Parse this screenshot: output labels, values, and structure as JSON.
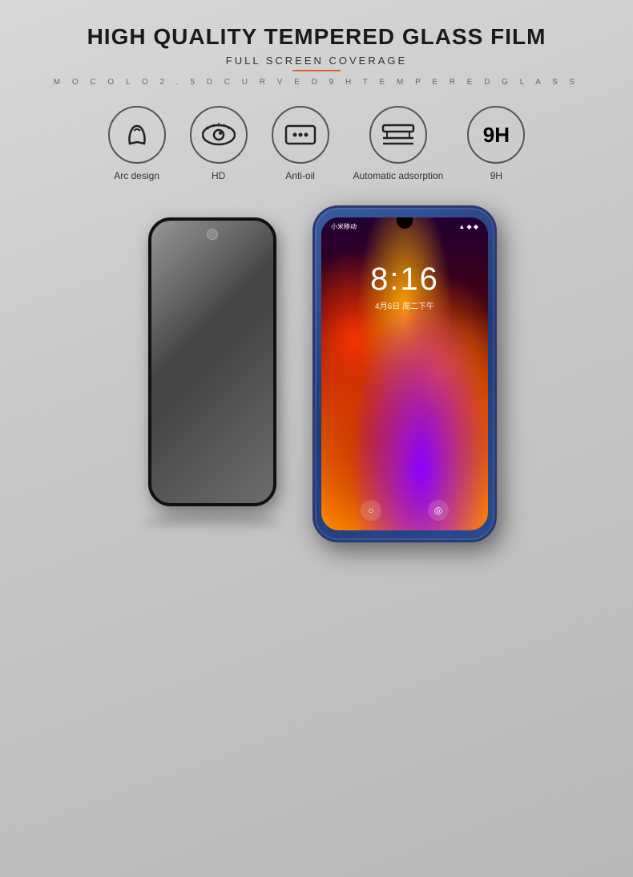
{
  "header": {
    "main_title": "HIGH QUALITY TEMPERED GLASS FILM",
    "sub_title": "FULL SCREEN COVERAGE",
    "tagline": "M O C O L O   2 . 5 D   C U R V E D   9 H   T E M P E R E D   G L A S S"
  },
  "features": [
    {
      "id": "arc-design",
      "icon": "◁",
      "label": "Arc design"
    },
    {
      "id": "hd",
      "icon": "👁",
      "label": "HD"
    },
    {
      "id": "anti-oil",
      "icon": "⊟",
      "label": "Anti-oil"
    },
    {
      "id": "auto-adsorption",
      "icon": "⊜",
      "label": "Automatic adsorption"
    },
    {
      "id": "9h",
      "icon": "9H",
      "label": "9H"
    }
  ],
  "phone": {
    "carrier": "小米移动",
    "time": "8:16",
    "date": "4月6日 周二下午",
    "signal_icons": "▲◆◆"
  },
  "colors": {
    "accent": "#e85d26",
    "background": "#cccccc",
    "title": "#1a1a1a"
  }
}
